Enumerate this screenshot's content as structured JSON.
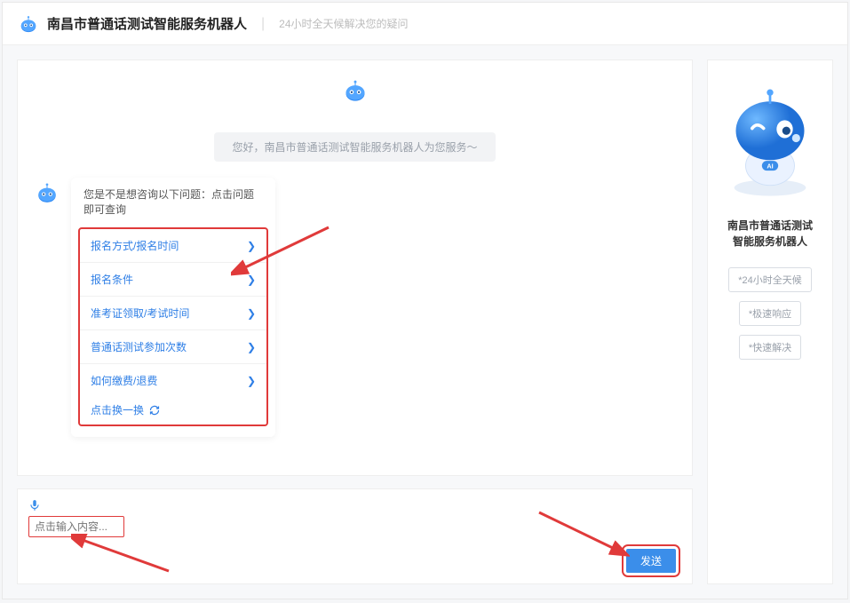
{
  "header": {
    "title": "南昌市普通话测试智能服务机器人",
    "subtitle": "24小时全天候解决您的疑问"
  },
  "chat": {
    "greeting": "您好，南昌市普通话测试智能服务机器人为您服务～",
    "suggestion_intro": "您是不是想咨询以下问题：点击问题即可查询",
    "questions": [
      "报名方式/报名时间",
      "报名条件",
      "准考证领取/考试时间",
      "普通话测试参加次数",
      "如何缴费/退费"
    ],
    "refresh_label": "点击换一换"
  },
  "input": {
    "placeholder": "点击输入内容...",
    "send_label": "发送"
  },
  "sidebar": {
    "title_line1": "南昌市普通话测试",
    "title_line2": "智能服务机器人",
    "tags": [
      "*24小时全天候",
      "*极速响应",
      "*快速解决"
    ]
  }
}
